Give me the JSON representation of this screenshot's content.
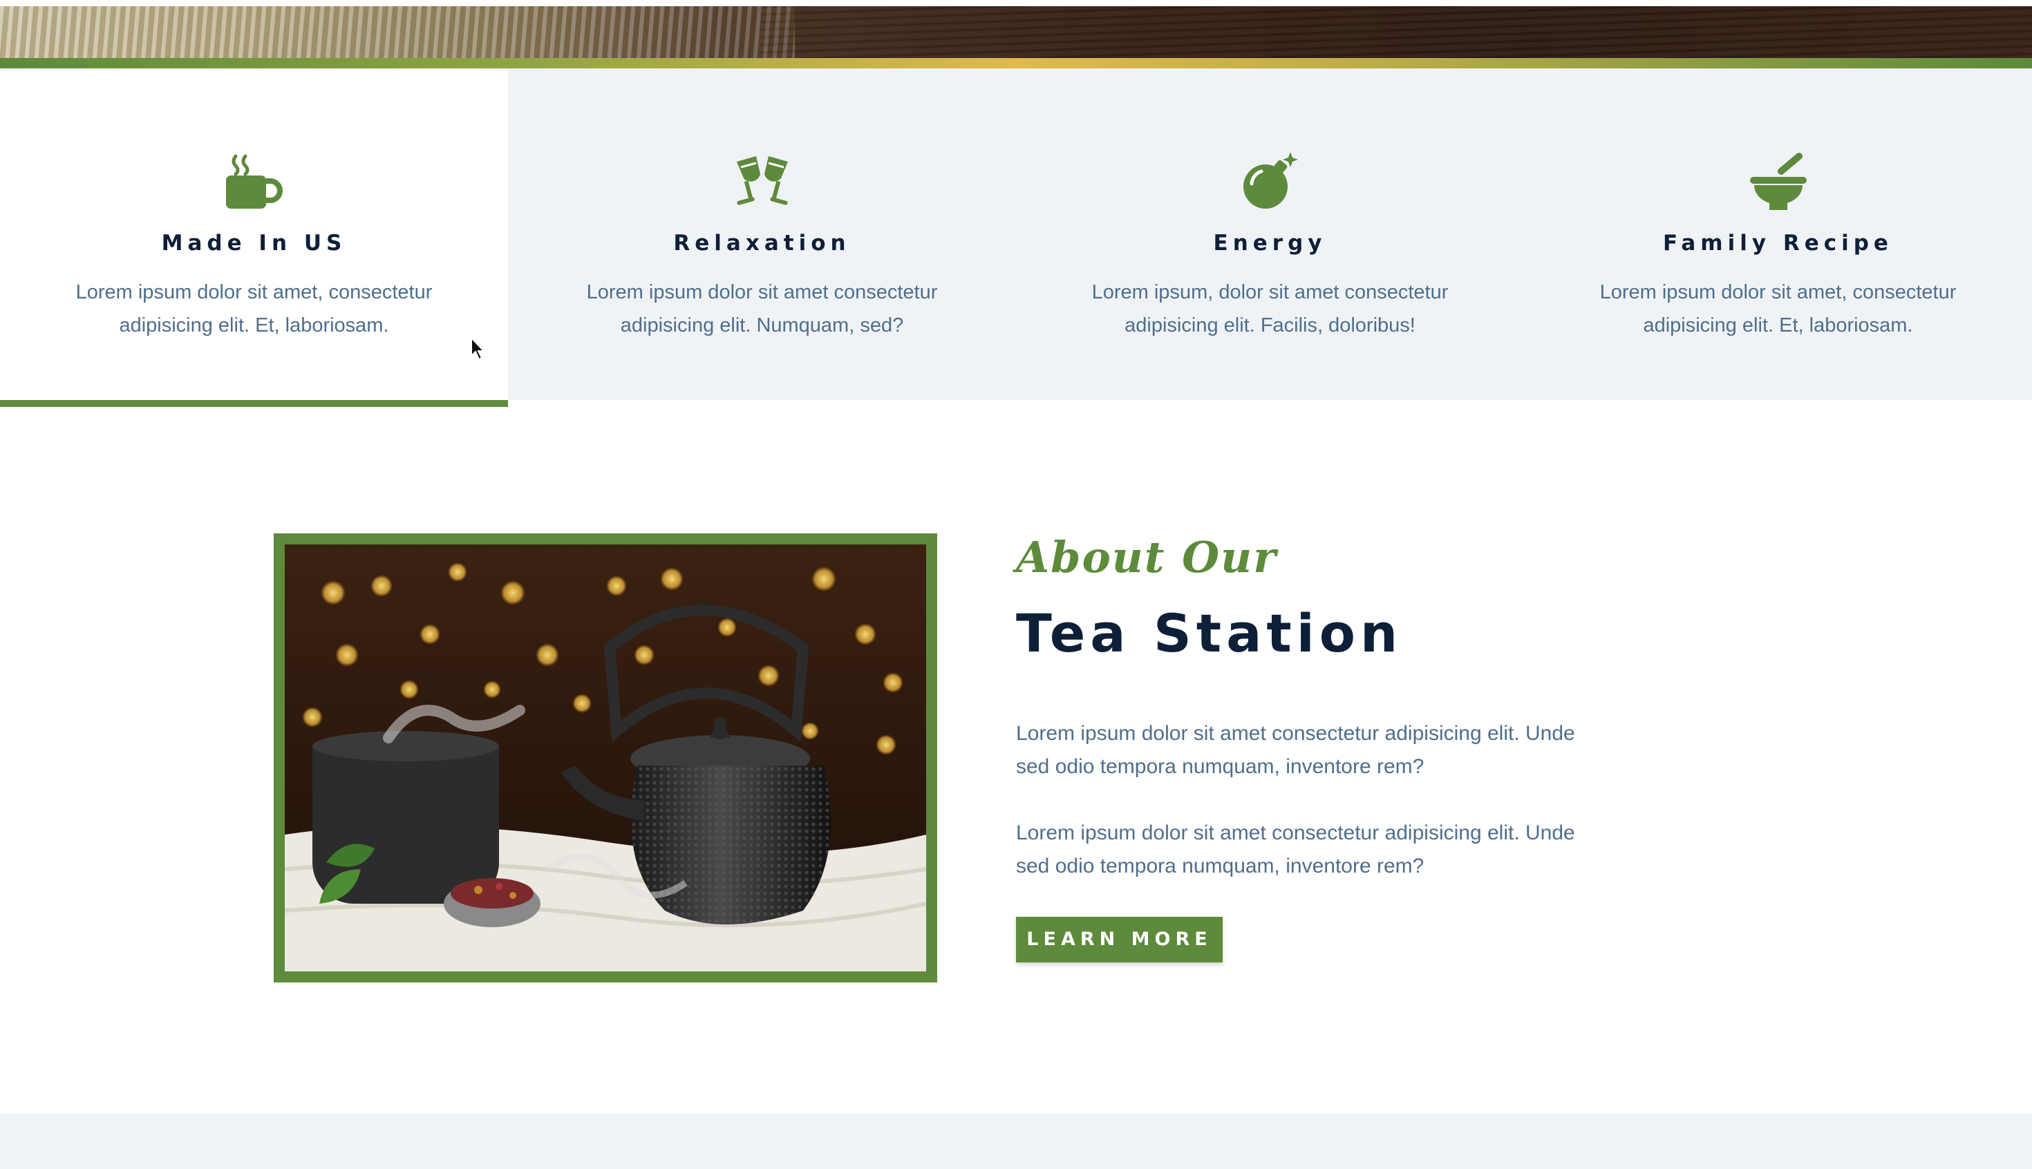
{
  "features": [
    {
      "title": "Made In US",
      "text": "Lorem ipsum dolor sit amet, consectetur adipisicing elit. Et, laboriosam.",
      "icon": "mug-hot-icon",
      "active": true
    },
    {
      "title": "Relaxation",
      "text": "Lorem ipsum dolor sit amet consectetur adipisicing elit. Numquam, sed?",
      "icon": "glasses-cheers-icon",
      "active": false
    },
    {
      "title": "Energy",
      "text": "Lorem ipsum, dolor sit amet consectetur adipisicing elit. Facilis, doloribus!",
      "icon": "bomb-icon",
      "active": false
    },
    {
      "title": "Family Recipe",
      "text": "Lorem ipsum dolor sit amet, consectetur adipisicing elit. Et, laboriosam.",
      "icon": "mortar-pestle-icon",
      "active": false
    }
  ],
  "about": {
    "script_heading": "About Our",
    "title": "Tea Station",
    "paragraphs": [
      "Lorem ipsum dolor sit amet consectetur adipisicing elit. Unde sed odio tempora numquam, inventore rem?",
      "Lorem ipsum dolor sit amet consectetur adipisicing elit. Unde sed odio tempora numquam, inventore rem?"
    ],
    "button_label": "LEARN MORE"
  },
  "colors": {
    "accent_green": "#5e8a3c",
    "heading_navy": "#0e1f38",
    "body_text": "#4f6e8c",
    "section_bg": "#f0f3f6"
  }
}
